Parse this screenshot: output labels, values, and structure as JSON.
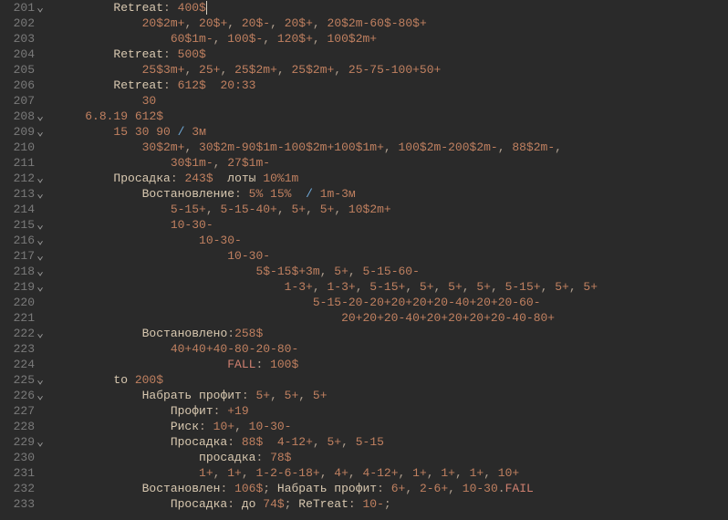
{
  "lines": [
    {
      "n": 201,
      "fold": true,
      "indent": 8,
      "tokens": [
        [
          "kw",
          "Retreat"
        ],
        [
          "op",
          ": "
        ],
        [
          "num",
          "400$"
        ],
        [
          "wh",
          "|"
        ]
      ]
    },
    {
      "n": 202,
      "fold": false,
      "indent": 12,
      "tokens": [
        [
          "num",
          "20$2m+"
        ],
        [
          "op",
          ", "
        ],
        [
          "num",
          "20$+"
        ],
        [
          "op",
          ", "
        ],
        [
          "num",
          "20$-"
        ],
        [
          "op",
          ", "
        ],
        [
          "num",
          "20$+"
        ],
        [
          "op",
          ", "
        ],
        [
          "num",
          "20$2m-60$-80$+"
        ]
      ]
    },
    {
      "n": 203,
      "fold": false,
      "indent": 16,
      "tokens": [
        [
          "num",
          "60$1m-"
        ],
        [
          "op",
          ", "
        ],
        [
          "num",
          "100$-"
        ],
        [
          "op",
          ", "
        ],
        [
          "num",
          "120$+"
        ],
        [
          "op",
          ", "
        ],
        [
          "num",
          "100$2m+"
        ]
      ]
    },
    {
      "n": 204,
      "fold": false,
      "indent": 8,
      "tokens": [
        [
          "kw",
          "Retreat"
        ],
        [
          "op",
          ": "
        ],
        [
          "num",
          "500$"
        ]
      ]
    },
    {
      "n": 205,
      "fold": false,
      "indent": 12,
      "tokens": [
        [
          "num",
          "25$3m+"
        ],
        [
          "op",
          ", "
        ],
        [
          "num",
          "25+"
        ],
        [
          "op",
          ", "
        ],
        [
          "num",
          "25$2m+"
        ],
        [
          "op",
          ", "
        ],
        [
          "num",
          "25$2m+"
        ],
        [
          "op",
          ", "
        ],
        [
          "num",
          "25-75-100+50+"
        ]
      ]
    },
    {
      "n": 206,
      "fold": false,
      "indent": 8,
      "tokens": [
        [
          "kw",
          "Retreat"
        ],
        [
          "op",
          ": "
        ],
        [
          "num",
          "612$"
        ],
        [
          "op",
          "  "
        ],
        [
          "num",
          "20:33"
        ]
      ]
    },
    {
      "n": 207,
      "fold": false,
      "indent": 12,
      "tokens": [
        [
          "num",
          "30"
        ]
      ]
    },
    {
      "n": 208,
      "fold": true,
      "indent": 4,
      "tokens": [
        [
          "num",
          "6.8.19"
        ],
        [
          "op",
          " "
        ],
        [
          "num",
          "612$"
        ]
      ]
    },
    {
      "n": 209,
      "fold": true,
      "indent": 8,
      "tokens": [
        [
          "num",
          "15 30 90"
        ],
        [
          "op",
          " "
        ],
        [
          "blue",
          "/"
        ],
        [
          "op",
          " "
        ],
        [
          "num",
          "3м"
        ]
      ]
    },
    {
      "n": 210,
      "fold": false,
      "indent": 12,
      "tokens": [
        [
          "num",
          "30$2m+"
        ],
        [
          "op",
          ", "
        ],
        [
          "num",
          "30$2m-90$1m-100$2m+100$1m+"
        ],
        [
          "op",
          ", "
        ],
        [
          "num",
          "100$2m-200$2m-"
        ],
        [
          "op",
          ", "
        ],
        [
          "num",
          "88$2m-"
        ],
        [
          "op",
          ","
        ]
      ]
    },
    {
      "n": 211,
      "fold": false,
      "indent": 16,
      "tokens": [
        [
          "num",
          "30$1m-"
        ],
        [
          "op",
          ", "
        ],
        [
          "num",
          "27$1m-"
        ]
      ]
    },
    {
      "n": 212,
      "fold": true,
      "indent": 8,
      "tokens": [
        [
          "kw",
          "Просадка"
        ],
        [
          "op",
          ": "
        ],
        [
          "num",
          "243$"
        ],
        [
          "op",
          "  "
        ],
        [
          "kw",
          "лоты"
        ],
        [
          "op",
          " "
        ],
        [
          "num",
          "10%1m"
        ]
      ]
    },
    {
      "n": 213,
      "fold": true,
      "indent": 12,
      "tokens": [
        [
          "kw",
          "Востановление"
        ],
        [
          "op",
          ": "
        ],
        [
          "num",
          "5% 15%"
        ],
        [
          "op",
          "  "
        ],
        [
          "blue",
          "/"
        ],
        [
          "op",
          " "
        ],
        [
          "num",
          "1m-3м"
        ]
      ]
    },
    {
      "n": 214,
      "fold": false,
      "indent": 16,
      "tokens": [
        [
          "num",
          "5-15+"
        ],
        [
          "op",
          ", "
        ],
        [
          "num",
          "5-15-40+"
        ],
        [
          "op",
          ", "
        ],
        [
          "num",
          "5+"
        ],
        [
          "op",
          ", "
        ],
        [
          "num",
          "5+"
        ],
        [
          "op",
          ", "
        ],
        [
          "num",
          "10$2m+"
        ]
      ]
    },
    {
      "n": 215,
      "fold": true,
      "indent": 16,
      "tokens": [
        [
          "num",
          "10-30-"
        ]
      ]
    },
    {
      "n": 216,
      "fold": true,
      "indent": 20,
      "tokens": [
        [
          "num",
          "10-30-"
        ]
      ]
    },
    {
      "n": 217,
      "fold": true,
      "indent": 24,
      "tokens": [
        [
          "num",
          "10-30-"
        ]
      ]
    },
    {
      "n": 218,
      "fold": true,
      "indent": 28,
      "tokens": [
        [
          "num",
          "5$-15$+3m"
        ],
        [
          "op",
          ", "
        ],
        [
          "num",
          "5+"
        ],
        [
          "op",
          ", "
        ],
        [
          "num",
          "5-15-60-"
        ]
      ]
    },
    {
      "n": 219,
      "fold": true,
      "indent": 32,
      "tokens": [
        [
          "num",
          "1-3+"
        ],
        [
          "op",
          ", "
        ],
        [
          "num",
          "1-3+"
        ],
        [
          "op",
          ", "
        ],
        [
          "num",
          "5-15+"
        ],
        [
          "op",
          ", "
        ],
        [
          "num",
          "5+"
        ],
        [
          "op",
          ", "
        ],
        [
          "num",
          "5+"
        ],
        [
          "op",
          ", "
        ],
        [
          "num",
          "5+"
        ],
        [
          "op",
          ", "
        ],
        [
          "num",
          "5-15+"
        ],
        [
          "op",
          ", "
        ],
        [
          "num",
          "5+"
        ],
        [
          "op",
          ", "
        ],
        [
          "num",
          "5+"
        ]
      ]
    },
    {
      "n": 220,
      "fold": false,
      "indent": 36,
      "tokens": [
        [
          "num",
          "5-15-20-20+20+20+20-40+20+20-60-"
        ]
      ]
    },
    {
      "n": 221,
      "fold": false,
      "indent": 40,
      "tokens": [
        [
          "num",
          "20+20+20-40+20+20+20+20-40-80+"
        ]
      ]
    },
    {
      "n": 222,
      "fold": true,
      "indent": 12,
      "tokens": [
        [
          "kw",
          "Востановлено"
        ],
        [
          "op",
          ":"
        ],
        [
          "num",
          "258$"
        ]
      ]
    },
    {
      "n": 223,
      "fold": false,
      "indent": 16,
      "tokens": [
        [
          "num",
          "40+40+40-80-20-80-"
        ]
      ]
    },
    {
      "n": 224,
      "fold": false,
      "indent": 24,
      "tokens": [
        [
          "red",
          "FALL"
        ],
        [
          "op",
          ": "
        ],
        [
          "num",
          "100$"
        ]
      ]
    },
    {
      "n": 225,
      "fold": true,
      "indent": 8,
      "tokens": [
        [
          "kw",
          "to "
        ],
        [
          "num",
          "200$"
        ]
      ]
    },
    {
      "n": 226,
      "fold": true,
      "indent": 12,
      "tokens": [
        [
          "kw",
          "Набрать профит"
        ],
        [
          "op",
          ": "
        ],
        [
          "num",
          "5+"
        ],
        [
          "op",
          ", "
        ],
        [
          "num",
          "5+"
        ],
        [
          "op",
          ", "
        ],
        [
          "num",
          "5+"
        ]
      ]
    },
    {
      "n": 227,
      "fold": false,
      "indent": 16,
      "tokens": [
        [
          "kw",
          "Профит"
        ],
        [
          "op",
          ": "
        ],
        [
          "num",
          "+19"
        ]
      ]
    },
    {
      "n": 228,
      "fold": false,
      "indent": 16,
      "tokens": [
        [
          "kw",
          "Риск"
        ],
        [
          "op",
          ": "
        ],
        [
          "num",
          "10+"
        ],
        [
          "op",
          ", "
        ],
        [
          "num",
          "10-30-"
        ]
      ]
    },
    {
      "n": 229,
      "fold": true,
      "indent": 16,
      "tokens": [
        [
          "kw",
          "Просадка"
        ],
        [
          "op",
          ": "
        ],
        [
          "num",
          "88$"
        ],
        [
          "op",
          "  "
        ],
        [
          "num",
          "4-12+"
        ],
        [
          "op",
          ", "
        ],
        [
          "num",
          "5+"
        ],
        [
          "op",
          ", "
        ],
        [
          "num",
          "5-15"
        ]
      ]
    },
    {
      "n": 230,
      "fold": false,
      "indent": 20,
      "tokens": [
        [
          "kw",
          "просадка"
        ],
        [
          "op",
          ": "
        ],
        [
          "num",
          "78$"
        ]
      ]
    },
    {
      "n": 231,
      "fold": false,
      "indent": 20,
      "tokens": [
        [
          "num",
          "1+"
        ],
        [
          "op",
          ", "
        ],
        [
          "num",
          "1+"
        ],
        [
          "op",
          ", "
        ],
        [
          "num",
          "1-2-6-18+"
        ],
        [
          "op",
          ", "
        ],
        [
          "num",
          "4+"
        ],
        [
          "op",
          ", "
        ],
        [
          "num",
          "4-12+"
        ],
        [
          "op",
          ", "
        ],
        [
          "num",
          "1+"
        ],
        [
          "op",
          ", "
        ],
        [
          "num",
          "1+"
        ],
        [
          "op",
          ", "
        ],
        [
          "num",
          "1+"
        ],
        [
          "op",
          ", "
        ],
        [
          "num",
          "10+"
        ]
      ]
    },
    {
      "n": 232,
      "fold": false,
      "indent": 12,
      "tokens": [
        [
          "kw",
          "Востановлен"
        ],
        [
          "op",
          ": "
        ],
        [
          "num",
          "106$"
        ],
        [
          "op",
          "; "
        ],
        [
          "kw",
          "Набрать профит"
        ],
        [
          "op",
          ": "
        ],
        [
          "num",
          "6+"
        ],
        [
          "op",
          ", "
        ],
        [
          "num",
          "2-6+"
        ],
        [
          "op",
          ", "
        ],
        [
          "num",
          "10-30"
        ],
        [
          "op",
          "."
        ],
        [
          "red",
          "FAIL"
        ]
      ]
    },
    {
      "n": 233,
      "fold": false,
      "indent": 16,
      "tokens": [
        [
          "kw",
          "Просадка"
        ],
        [
          "op",
          ": "
        ],
        [
          "kw",
          "до "
        ],
        [
          "num",
          "74$"
        ],
        [
          "op",
          "; "
        ],
        [
          "kw",
          "ReTreat"
        ],
        [
          "op",
          ": "
        ],
        [
          "num",
          "10-"
        ],
        [
          "op",
          ";"
        ]
      ]
    }
  ]
}
